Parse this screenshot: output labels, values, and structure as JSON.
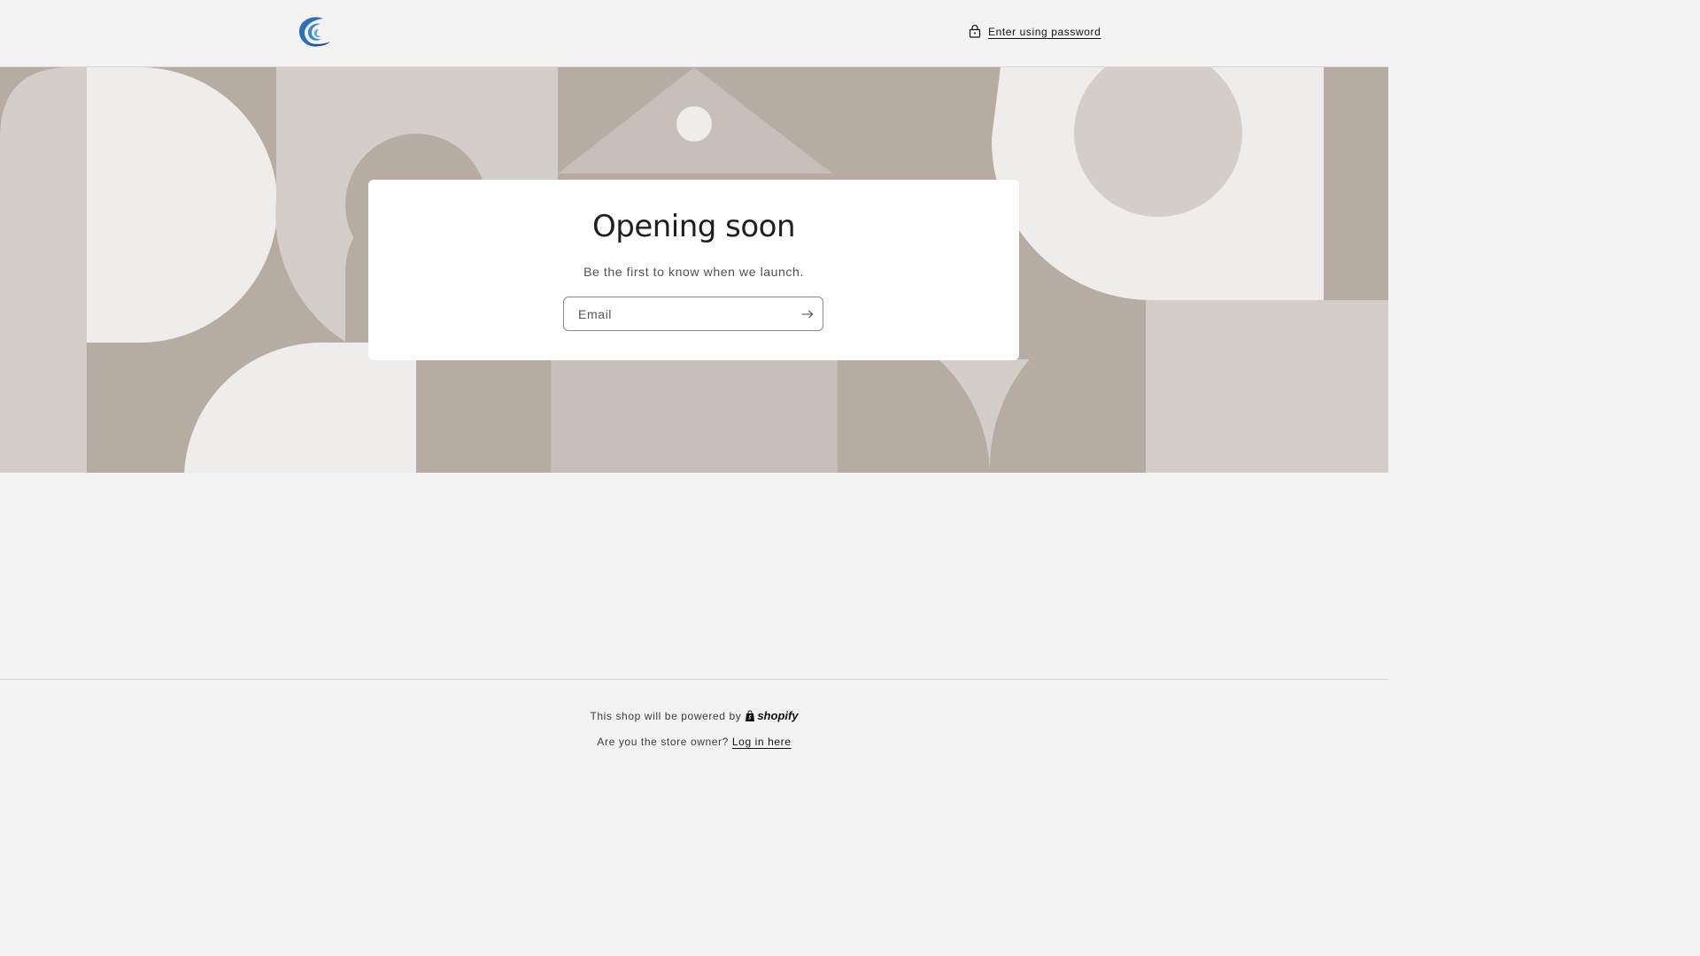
{
  "header": {
    "logo_icon": "wave-logo-icon",
    "password_link_label": "Enter using password",
    "password_link_icon": "lock-icon"
  },
  "colors": {
    "background": "#f3f3f3",
    "banner_dark": "#b6aca1",
    "banner_mid": "#c7bfb8",
    "banner_light": "#d3ceca",
    "banner_pale": "#eeedeb",
    "logo_blue": "#2c6fb7"
  },
  "newsletter": {
    "title": "Opening soon",
    "subtitle": "Be the first to know when we launch.",
    "email_placeholder": "Email",
    "email_value": "",
    "submit_icon": "arrow-right-icon"
  },
  "footer": {
    "powered_by_text": "This shop will be powered by",
    "shopify_brand": "shopify",
    "owner_question": "Are you the store owner?",
    "login_link": "Log in here"
  }
}
